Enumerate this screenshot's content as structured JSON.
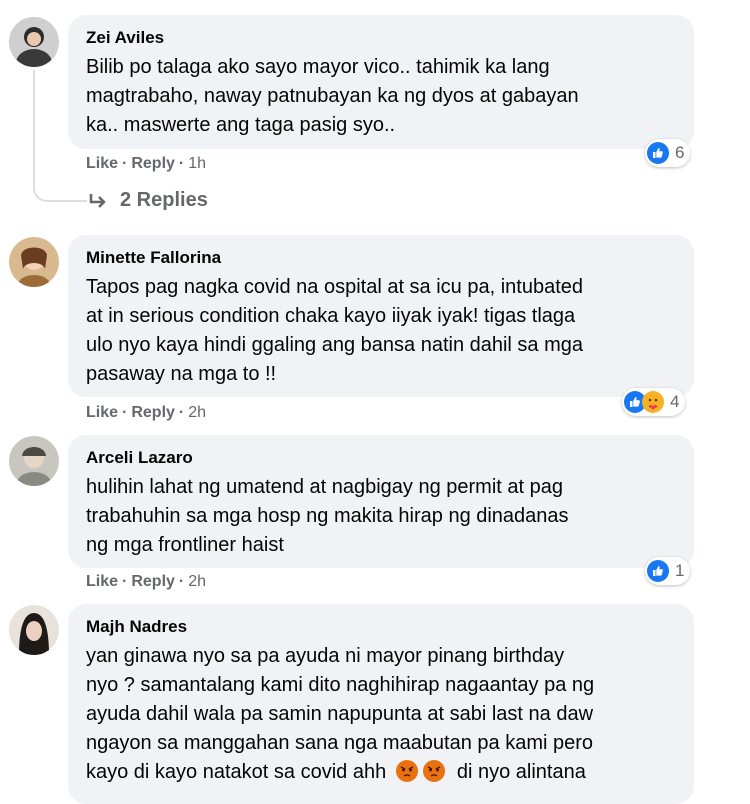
{
  "comments": [
    {
      "name": "Zei Aviles",
      "lines": [
        "Bilib po talaga ako sayo mayor vico.. tahimik ka lang",
        "magtrabaho, naway patnubayan ka ng dyos at gabayan",
        "ka.. maswerte ang taga pasig syo.."
      ],
      "like": "Like",
      "reply": "Reply",
      "time": "1h",
      "reactions": [
        "like-icon"
      ],
      "reaction_count": "6",
      "replies_label": "2 Replies"
    },
    {
      "name": "Minette Fallorina",
      "lines": [
        "Tapos pag nagka covid na ospital at sa icu pa, intubated",
        "at in serious condition chaka kayo iiyak iyak! tigas tlaga",
        "ulo nyo kaya hindi ggaling ang bansa natin dahil sa mga",
        "pasaway na mga to !!"
      ],
      "like": "Like",
      "reply": "Reply",
      "time": "2h",
      "reactions": [
        "like-icon",
        "care-icon"
      ],
      "reaction_count": "4"
    },
    {
      "name": "Arceli Lazaro",
      "lines": [
        "hulihin lahat ng umatend at nagbigay ng permit at pag",
        "trabahuhin sa mga hosp ng makita hirap ng dinadanas",
        "ng mga frontliner haist"
      ],
      "like": "Like",
      "reply": "Reply",
      "time": "2h",
      "reactions": [
        "like-icon"
      ],
      "reaction_count": "1"
    },
    {
      "name": "Majh Nadres",
      "lines": [
        "yan ginawa nyo sa pa ayuda ni mayor pinang birthday",
        "nyo ? samantalang kami dito naghihirap nagaantay pa ng",
        "ayuda dahil wala pa samin napupunta at sabi last na daw",
        "ngayon sa manggahan sana nga maabutan pa kami pero",
        "kayo di kayo natakot sa covid ahh",
        "di nyo alintana"
      ],
      "emoji_inline": [
        "angry-icon",
        "angry-icon"
      ]
    }
  ],
  "colors": {
    "bubble": "#f0f2f5",
    "meta": "#65676b",
    "like_blue": "#1877f2",
    "care_yellow": "#f7b125",
    "angry": "#e9710f"
  }
}
